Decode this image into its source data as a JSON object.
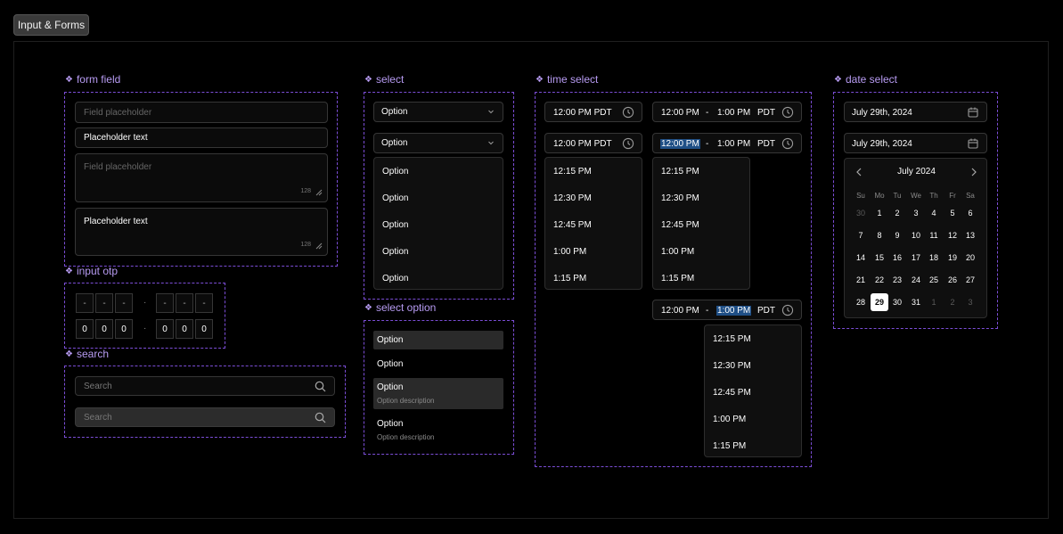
{
  "page": {
    "tag": "Input & Forms"
  },
  "form_field": {
    "title": "form field",
    "input1": "Field placeholder",
    "input2": "Placeholder text",
    "area1": "Field placeholder",
    "area2": "Placeholder text",
    "count": "128"
  },
  "input_otp": {
    "title": "input otp",
    "empty": [
      "-",
      "-",
      "-",
      "-",
      "-",
      "-"
    ],
    "filled": [
      "0",
      "0",
      "0",
      "0",
      "0",
      "0"
    ],
    "separator": "·"
  },
  "search": {
    "title": "search",
    "placeholder1": "Search",
    "placeholder2": "Search"
  },
  "select": {
    "title": "select",
    "value1": "Option",
    "value2": "Option",
    "options": [
      "Option",
      "Option",
      "Option",
      "Option",
      "Option"
    ]
  },
  "select_option": {
    "title": "select option",
    "items": [
      {
        "label": "Option",
        "desc": ""
      },
      {
        "label": "Option",
        "desc": ""
      },
      {
        "label": "Option",
        "desc": "Option description"
      },
      {
        "label": "Option",
        "desc": "Option description"
      }
    ]
  },
  "time_select": {
    "title": "time select",
    "single1": "12:00 PM PDT",
    "single2": "12:00 PM PDT",
    "range_start": "12:00 PM",
    "range_sep": "-",
    "range_end": "1:00 PM",
    "tz": "PDT",
    "times": [
      "12:15 PM",
      "12:30 PM",
      "12:45 PM",
      "1:00 PM",
      "1:15 PM"
    ]
  },
  "date_select": {
    "title": "date select",
    "value1": "July 29th, 2024",
    "value2": "July 29th, 2024",
    "month": "July 2024",
    "weekdays": [
      "Su",
      "Mo",
      "Tu",
      "We",
      "Th",
      "Fr",
      "Sa"
    ],
    "weeks": [
      [
        "30",
        "1",
        "2",
        "3",
        "4",
        "5",
        "6"
      ],
      [
        "7",
        "8",
        "9",
        "10",
        "11",
        "12",
        "13"
      ],
      [
        "14",
        "15",
        "16",
        "17",
        "18",
        "19",
        "20"
      ],
      [
        "21",
        "22",
        "23",
        "24",
        "25",
        "26",
        "27"
      ],
      [
        "28",
        "29",
        "30",
        "31",
        "1",
        "2",
        "3"
      ]
    ],
    "selected_day": "29"
  },
  "colors": {
    "accent": "#b79bf2",
    "dashed_border": "#7b4dd6",
    "selection": "#1f4f86"
  }
}
